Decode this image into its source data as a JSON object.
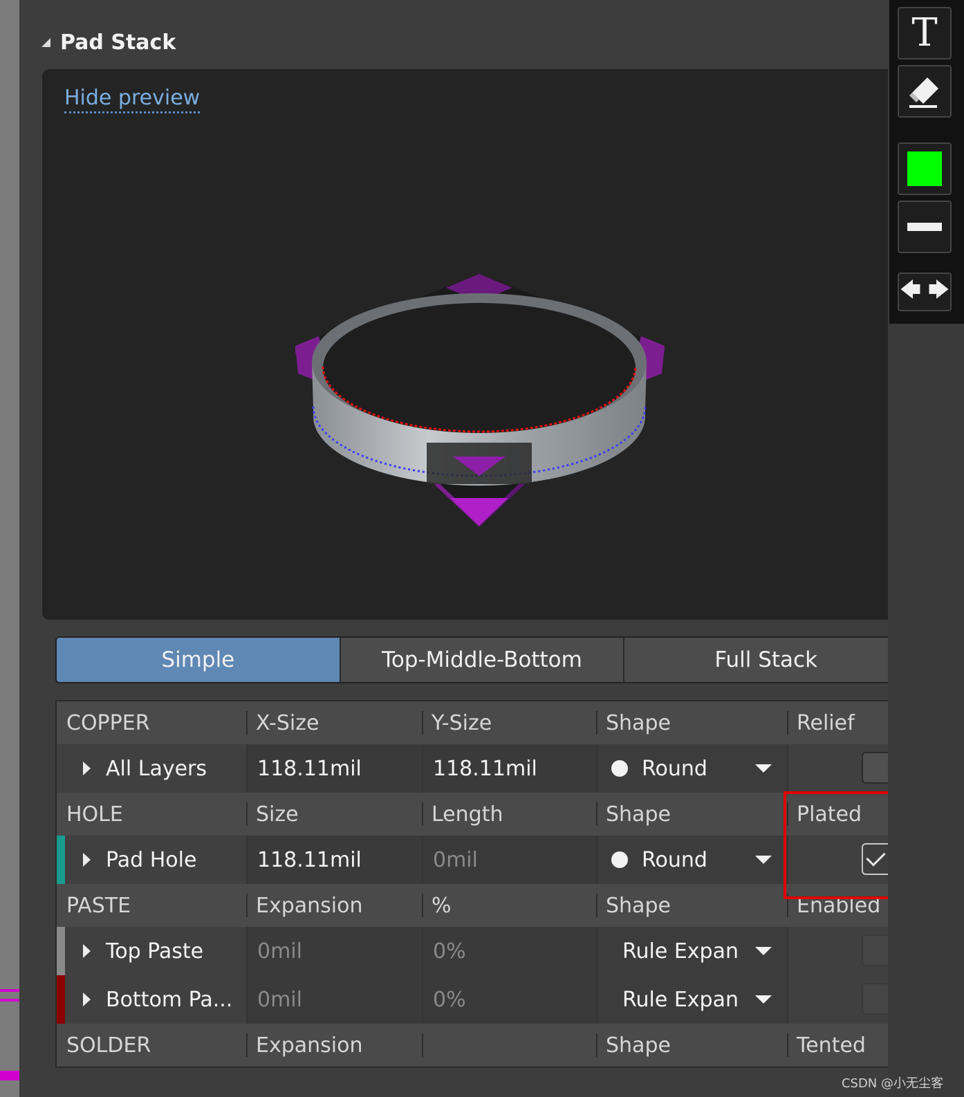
{
  "section": {
    "title": "Pad Stack"
  },
  "preview": {
    "hide_label": "Hide preview"
  },
  "tabs": [
    {
      "label": "Simple",
      "active": true
    },
    {
      "label": "Top-Middle-Bottom",
      "active": false
    },
    {
      "label": "Full Stack",
      "active": false
    }
  ],
  "grid": {
    "copper_header": {
      "c1": "COPPER",
      "c2": "X-Size",
      "c3": "Y-Size",
      "c4": "Shape",
      "c5": "Relief"
    },
    "all_layers": {
      "name": "All Layers",
      "x": "118.11mil",
      "y": "118.11mil",
      "shape": "Round",
      "relief_checked": false
    },
    "hole_header": {
      "c1": "HOLE",
      "c2": "Size",
      "c3": "Length",
      "c4": "Shape",
      "c5": "Plated"
    },
    "pad_hole": {
      "name": "Pad Hole",
      "size": "118.11mil",
      "length": "0mil",
      "shape": "Round",
      "plated_checked": true,
      "color": "#1a9a8c"
    },
    "paste_header": {
      "c1": "PASTE",
      "c2": "Expansion",
      "c3": "%",
      "c4": "Shape",
      "c5": "Enabled"
    },
    "top_paste": {
      "name": "Top Paste",
      "expansion": "0mil",
      "percent": "0%",
      "shape": "Rule Expan",
      "color": "#8a8a8a"
    },
    "bottom_paste": {
      "name": "Bottom Pa...",
      "expansion": "0mil",
      "percent": "0%",
      "shape": "Rule Expan",
      "color": "#8a0000"
    },
    "solder_header": {
      "c1": "SOLDER",
      "c2": "Expansion",
      "c3": "",
      "c4": "Shape",
      "c5": "Tented"
    }
  },
  "toolbar": {
    "text_glyph": "T",
    "eraser_icon": "eraser-icon",
    "color_swatch": "#00ff00",
    "line_icon": "line-width-icon",
    "arrows": {
      "left": "🡄",
      "right": "🡆"
    }
  },
  "watermark": "CSDN @小无尘客"
}
